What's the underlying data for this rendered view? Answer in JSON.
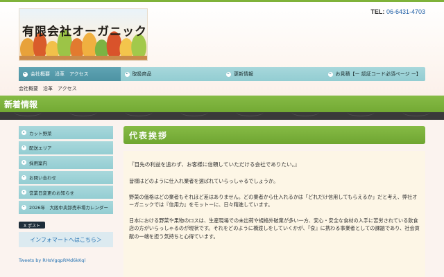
{
  "header": {
    "logo_text": "有限会社オーガニック",
    "tel_label": "TEL:",
    "tel_number": "06-6431-4703"
  },
  "gnav": [
    {
      "label": "会社概要　沿革　アクセス",
      "active": true
    },
    {
      "label": "取扱商品",
      "active": false
    },
    {
      "label": "更新情報",
      "active": false
    },
    {
      "label": "お見積【ー 認証コード必須ページ ー】",
      "active": false
    }
  ],
  "subnav": "会社概要　沿革　アクセス",
  "band_title": "新着情報",
  "sidebar": {
    "items": [
      {
        "label": "カット野菜"
      },
      {
        "label": "配送エリア"
      },
      {
        "label": "採用案内"
      },
      {
        "label": "お問い合わせ"
      },
      {
        "label": "営業日変更のお知らせ"
      },
      {
        "label": "2026年　大阪中央卸売市場カレンダー"
      }
    ],
    "tweet_button": "X ポスト",
    "infomart_link": "インフォマートへはこちら＞",
    "tweets_link": "Tweets by RHsVgqpRMd6kKql"
  },
  "main": {
    "section_title": "代表挨拶",
    "paragraphs": [
      "『目先の利益を追わず、お客様に信頼していただける会社でありたい。』",
      "皆様はどのように仕入れ業者を選ばれていらっしゃるでしょうか。",
      "野菜の価格はどの業者もそれほど差はありません。どの業者から仕入れるかは「どれだけ信用してもらえるか」だと考え、弊社オーガニックでは『信用力』をモットーに、日々精進しています。",
      "日本における野菜や果物のロスは、生産現場での未出荷や規格外破棄が多い一方、安心・安全な食材の入手に苦労されている飲食店の方がいらっしゃるのが現状です。それをどのように橋渡しをしていくかが、『食』に携わる事業者としての課題であり、社会貢献の一端を担う気持ちと心得ています。"
    ]
  },
  "colors": {
    "green": "#7fb23a",
    "teal_nav": "#93cdd2",
    "teal_active": "#4d93a3",
    "link_blue": "#1f6fb0"
  }
}
